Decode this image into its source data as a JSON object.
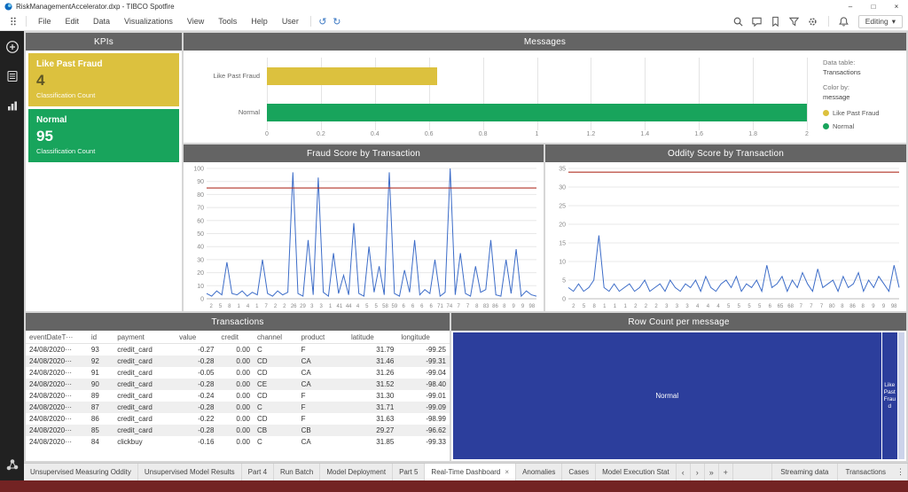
{
  "window": {
    "title": "RiskManagementAccelerator.dxp - TIBCO Spotfire",
    "minimize": "–",
    "maximize": "□",
    "close": "×"
  },
  "menubar": {
    "items": [
      "File",
      "Edit",
      "Data",
      "Visualizations",
      "View",
      "Tools",
      "Help",
      "User"
    ],
    "undo": "↺",
    "redo": "↻",
    "icons": [
      "search-icon",
      "comment-icon",
      "bookmark-icon",
      "filter-icon",
      "settings-icon",
      "notifications-icon"
    ],
    "editing": "Editing",
    "editing_caret": "▾"
  },
  "sidebar": {
    "icons": [
      "add-icon",
      "data-icon",
      "analytics-icon",
      "collaboration-icon"
    ]
  },
  "panels": {
    "kpis": "KPIs",
    "messages": "Messages",
    "fraud": "Fraud Score by Transaction",
    "oddity": "Oddity Score by Transaction",
    "transactions": "Transactions",
    "rowcount": "Row Count per message"
  },
  "kpi_cards": [
    {
      "label": "Like Past Fraud",
      "value": "4",
      "sublabel": "Classification Count",
      "color": "#dcc13e",
      "value_color": "#5d5526",
      "text_color": "#ffffff"
    },
    {
      "label": "Normal",
      "value": "95",
      "sublabel": "Classification Count",
      "color": "#18a45c",
      "value_color": "#ffffff",
      "text_color": "#ffffff"
    }
  ],
  "messages_info": {
    "data_table_label": "Data table:",
    "data_table_value": "Transactions",
    "color_by_label": "Color by:",
    "color_by_value": "message",
    "legend": [
      {
        "label": "Like Past Fraud",
        "color": "#dcc13e"
      },
      {
        "label": "Normal",
        "color": "#18a45c"
      }
    ]
  },
  "chart_data": [
    {
      "id": "messages_bar",
      "type": "bar",
      "title": "Messages",
      "orientation": "horizontal",
      "categories": [
        "Like Past Fraud",
        "Normal"
      ],
      "values": [
        0.63,
        2.0
      ],
      "colors": [
        "#dcc13e",
        "#18a45c"
      ],
      "xlim": [
        0,
        2
      ],
      "xtick_labels": [
        "0",
        "0.2",
        "0.4",
        "0.6",
        "0.8",
        "1",
        "1.2",
        "1.4",
        "1.6",
        "1.8",
        "2"
      ]
    },
    {
      "id": "fraud_line",
      "type": "line",
      "title": "Fraud Score by Transaction",
      "ylim": [
        0,
        100
      ],
      "yticks": [
        0,
        10,
        20,
        30,
        40,
        50,
        60,
        70,
        80,
        90,
        100
      ],
      "threshold": 85,
      "line_color": "#3c6cc8",
      "threshold_color": "#b23327",
      "xtick_labels": [
        "2",
        "5",
        "8",
        "1",
        "4",
        "1",
        "7",
        "2",
        "2",
        "26",
        "29",
        "3",
        "3",
        "1",
        "41",
        "44",
        "4",
        "5",
        "5",
        "58",
        "59",
        "6",
        "6",
        "6",
        "6",
        "71",
        "74",
        "7",
        "7",
        "8",
        "83",
        "86",
        "8",
        "9",
        "9",
        "98"
      ],
      "values": [
        4,
        2,
        6,
        3,
        28,
        4,
        3,
        6,
        2,
        5,
        3,
        30,
        4,
        2,
        6,
        3,
        5,
        97,
        4,
        2,
        45,
        3,
        93,
        5,
        2,
        35,
        4,
        18,
        3,
        58,
        4,
        2,
        40,
        5,
        25,
        3,
        97,
        4,
        2,
        22,
        5,
        45,
        3,
        7,
        4,
        30,
        2,
        5,
        100,
        3,
        35,
        4,
        2,
        25,
        5,
        7,
        45,
        3,
        2,
        30,
        4,
        38,
        2,
        6,
        3,
        2
      ]
    },
    {
      "id": "oddity_line",
      "type": "line",
      "title": "Oddity Score by Transaction",
      "ylim": [
        0,
        35
      ],
      "yticks": [
        0,
        5,
        10,
        15,
        20,
        25,
        30,
        35
      ],
      "threshold": 34,
      "line_color": "#3c6cc8",
      "threshold_color": "#b23327",
      "xtick_labels": [
        "2",
        "5",
        "8",
        "1",
        "1",
        "1",
        "2",
        "2",
        "2",
        "3",
        "3",
        "3",
        "4",
        "4",
        "4",
        "5",
        "5",
        "5",
        "5",
        "6",
        "65",
        "68",
        "7",
        "7",
        "7",
        "80",
        "8",
        "86",
        "8",
        "9",
        "9",
        "98"
      ],
      "values": [
        3,
        2,
        4,
        2,
        3,
        5,
        17,
        3,
        2,
        4,
        2,
        3,
        4,
        2,
        3,
        5,
        2,
        3,
        4,
        2,
        5,
        3,
        2,
        4,
        3,
        5,
        2,
        6,
        3,
        2,
        4,
        5,
        3,
        6,
        2,
        4,
        3,
        5,
        2,
        9,
        3,
        4,
        6,
        2,
        5,
        3,
        7,
        4,
        2,
        8,
        3,
        4,
        5,
        2,
        6,
        3,
        4,
        7,
        2,
        5,
        3,
        6,
        4,
        2,
        9,
        3
      ]
    },
    {
      "id": "rowcount_treemap",
      "type": "treemap",
      "title": "Row Count per message",
      "tiles": [
        {
          "label": "Normal",
          "share": 0.965,
          "color": "#2c3e9c",
          "label_lines": [
            "Normal"
          ]
        },
        {
          "label": "Like Past Fraud",
          "share": 0.035,
          "color": "#2c3e9c",
          "label_lines": [
            "Like",
            "Past",
            "Frau",
            "d"
          ]
        }
      ]
    }
  ],
  "transactions_table": {
    "columns": [
      {
        "label": "eventDateT···",
        "align": "left"
      },
      {
        "label": "id",
        "align": "left"
      },
      {
        "label": "payment",
        "align": "left"
      },
      {
        "label": "value",
        "align": "right"
      },
      {
        "label": "credit",
        "align": "right"
      },
      {
        "label": "channel",
        "align": "left"
      },
      {
        "label": "product",
        "align": "left"
      },
      {
        "label": "latitude",
        "align": "right"
      },
      {
        "label": "longitude",
        "align": "right"
      }
    ],
    "rows": [
      [
        "24/08/2020···",
        "93",
        "credit_card",
        "-0.27",
        "0.00",
        "C",
        "F",
        "31.79",
        "-99.25"
      ],
      [
        "24/08/2020···",
        "92",
        "credit_card",
        "-0.28",
        "0.00",
        "CD",
        "CA",
        "31.46",
        "-99.31"
      ],
      [
        "24/08/2020···",
        "91",
        "credit_card",
        "-0.05",
        "0.00",
        "CD",
        "CA",
        "31.26",
        "-99.04"
      ],
      [
        "24/08/2020···",
        "90",
        "credit_card",
        "-0.28",
        "0.00",
        "CE",
        "CA",
        "31.52",
        "-98.40"
      ],
      [
        "24/08/2020···",
        "89",
        "credit_card",
        "-0.24",
        "0.00",
        "CD",
        "F",
        "31.30",
        "-99.01"
      ],
      [
        "24/08/2020···",
        "87",
        "credit_card",
        "-0.28",
        "0.00",
        "C",
        "F",
        "31.71",
        "-99.09"
      ],
      [
        "24/08/2020···",
        "86",
        "credit_card",
        "-0.22",
        "0.00",
        "CD",
        "F",
        "31.63",
        "-98.99"
      ],
      [
        "24/08/2020···",
        "85",
        "credit_card",
        "-0.28",
        "0.00",
        "CB",
        "CB",
        "29.27",
        "-96.62"
      ],
      [
        "24/08/2020···",
        "84",
        "clickbuy",
        "-0.16",
        "0.00",
        "C",
        "CA",
        "31.85",
        "-99.33"
      ]
    ]
  },
  "tabs": {
    "pages": [
      {
        "label": "Unsupervised Measuring Oddity",
        "active": false
      },
      {
        "label": "Unsupervised Model Results",
        "active": false
      },
      {
        "label": "Part 4",
        "active": false
      },
      {
        "label": "Run Batch",
        "active": false
      },
      {
        "label": "Model Deployment",
        "active": false
      },
      {
        "label": "Part 5",
        "active": false
      },
      {
        "label": "Real-Time Dashboard",
        "active": true
      },
      {
        "label": "Anomalies",
        "active": false
      },
      {
        "label": "Cases",
        "active": false
      },
      {
        "label": "Model Execution Stat",
        "active": false
      }
    ],
    "close_glyph": "×",
    "controls": [
      {
        "name": "tab-scroll-left",
        "glyph": "‹"
      },
      {
        "name": "tab-scroll-right",
        "glyph": "›"
      },
      {
        "name": "tab-last",
        "glyph": "»"
      },
      {
        "name": "add-page-button",
        "glyph": "+"
      }
    ],
    "data_tabs": [
      "Streaming data",
      "Transactions"
    ],
    "overflow_glyph": "⋮"
  }
}
